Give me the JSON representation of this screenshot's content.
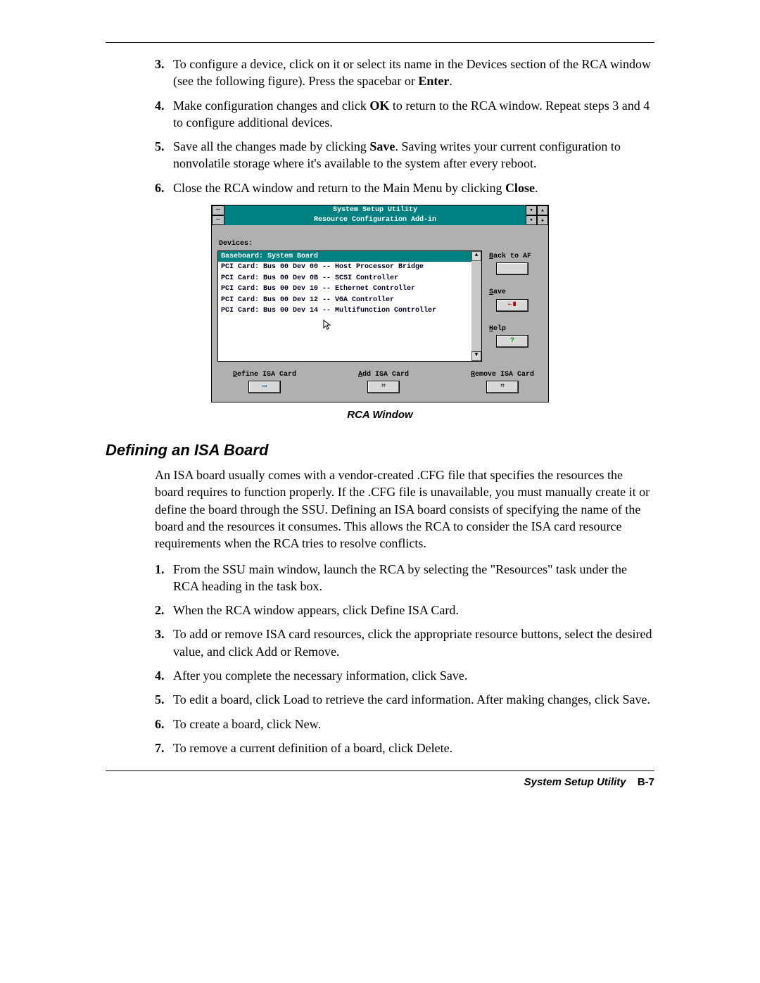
{
  "steps_a": [
    {
      "n": "3.",
      "html": "To configure a device, click on it or select its name in the Devices section of the RCA window (see the following figure). Press the spacebar or <b>Enter</b>."
    },
    {
      "n": "4.",
      "html": "Make configuration changes and click <b>OK</b> to return to the RCA window. Repeat steps 3 and 4 to configure additional devices."
    },
    {
      "n": "5.",
      "html": "Save all the changes made by clicking <b>Save</b>. Saving writes your current configuration to nonvolatile storage where it's available to the system after every reboot."
    },
    {
      "n": "6.",
      "html": "Close the RCA window and return to the Main Menu by clicking <b>Close</b>."
    }
  ],
  "figure": {
    "outer_title": "System Setup Utility",
    "inner_title": "Resource Configuration Add-in",
    "devices_label": "Devices:",
    "list": [
      {
        "text": "Baseboard: System Board",
        "selected": true
      },
      {
        "text": "PCI Card: Bus 00 Dev 00 -- Host Processor Bridge"
      },
      {
        "text": "PCI Card: Bus 00 Dev 0B -- SCSI Controller"
      },
      {
        "text": "PCI Card: Bus 00 Dev 10 -- Ethernet Controller"
      },
      {
        "text": "PCI Card: Bus 00 Dev 12 -- VGA Controller"
      },
      {
        "text": "PCI Card: Bus 00 Dev 14 -- Multifunction Controller"
      }
    ],
    "side_buttons": {
      "back": "Back to AF",
      "save": "Save",
      "help": "Help"
    },
    "bottom_buttons": {
      "define": "Define ISA Card",
      "add": "Add ISA Card",
      "remove": "Remove ISA Card"
    },
    "caption": "RCA Window"
  },
  "section_heading": "Defining an ISA Board",
  "section_para": "An ISA board usually comes with a vendor-created .CFG file that specifies the resources the board requires to function properly. If the .CFG file is unavailable, you must manually create it or define the board through the SSU. Defining an ISA board consists of specifying the name of the board and the resources it consumes. This allows the RCA to consider the ISA card resource requirements when the RCA tries to resolve conflicts.",
  "steps_b": [
    {
      "n": "1.",
      "html": "From the SSU main window, launch the RCA by selecting the \"Resources\" task under the RCA heading in the task box."
    },
    {
      "n": "2.",
      "html": "When the RCA window appears, click Define ISA Card."
    },
    {
      "n": "3.",
      "html": "To add or remove ISA card resources, click the appropriate resource buttons, select the desired value, and click Add or Remove."
    },
    {
      "n": "4.",
      "html": "After you complete the necessary information, click Save."
    },
    {
      "n": "5.",
      "html": "To edit a board, click Load to retrieve the card information. After making changes, click Save."
    },
    {
      "n": "6.",
      "html": "To create a board, click New."
    },
    {
      "n": "7.",
      "html": "To remove a current definition of a board, click Delete."
    }
  ],
  "footer": {
    "title": "System Setup Utility",
    "page": "B-7"
  }
}
